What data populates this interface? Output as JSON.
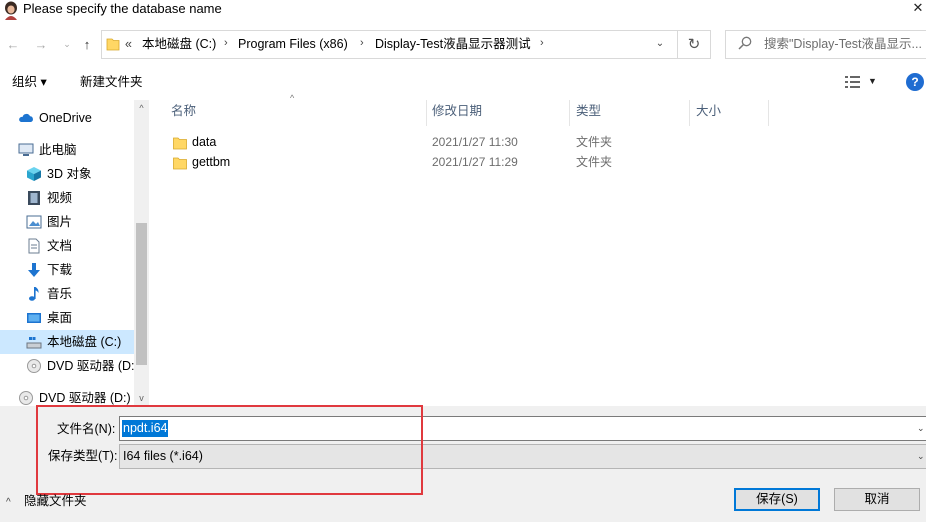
{
  "window": {
    "title": "Please specify the database name",
    "close_glyph": "✕"
  },
  "nav": {
    "back_glyph": "←",
    "forward_glyph": "→",
    "recent_glyph": "⌄",
    "up_glyph": "↑"
  },
  "address": {
    "overflow": "«",
    "crumbs": [
      "本地磁盘 (C:)",
      "Program Files (x86)",
      "Display-Test液晶显示器测试"
    ],
    "separator": "›",
    "dropdown_glyph": "⌄",
    "refresh_glyph": "↻"
  },
  "search": {
    "placeholder": "搜索\"Display-Test液晶显示..."
  },
  "toolbar": {
    "organize": "组织 ▾",
    "new_folder": "新建文件夹",
    "view_chevron": "▼",
    "help": "?"
  },
  "sidebar": {
    "scroll_up": "^",
    "scroll_down": "v",
    "items": [
      {
        "label": "OneDrive",
        "icon": "cloud-icon"
      },
      {
        "label": "此电脑",
        "icon": "computer-icon"
      },
      {
        "label": "3D 对象",
        "icon": "cube-icon"
      },
      {
        "label": "视频",
        "icon": "video-icon"
      },
      {
        "label": "图片",
        "icon": "picture-icon"
      },
      {
        "label": "文档",
        "icon": "document-icon"
      },
      {
        "label": "下载",
        "icon": "download-icon"
      },
      {
        "label": "音乐",
        "icon": "music-icon"
      },
      {
        "label": "桌面",
        "icon": "desktop-icon"
      },
      {
        "label": "本地磁盘 (C:)",
        "icon": "drive-icon",
        "selected": true
      },
      {
        "label": "DVD 驱动器 (D:",
        "icon": "dvd-icon"
      },
      {
        "label": "DVD 驱动器 (D:)",
        "icon": "dvd-icon"
      }
    ]
  },
  "files": {
    "columns": [
      "名称",
      "修改日期",
      "类型",
      "大小"
    ],
    "sort_glyph": "^",
    "rows": [
      {
        "name": "data",
        "date": "2021/1/27 11:30",
        "type": "文件夹"
      },
      {
        "name": "gettbm",
        "date": "2021/1/27 11:29",
        "type": "文件夹"
      }
    ]
  },
  "form": {
    "filename_label": "文件名(N):",
    "filename_value": "npdt.i64",
    "filetype_label": "保存类型(T):",
    "filetype_value": "I64 files (*.i64)",
    "dropdown_glyph": "⌄"
  },
  "footer": {
    "hide_folders": "隐藏文件夹",
    "hide_glyph": "^",
    "save": "保存(S)",
    "cancel": "取消"
  },
  "colors": {
    "accent": "#0078d7",
    "selection": "#cce8ff",
    "highlight_box": "#e0393e",
    "folder": "#ffd765"
  }
}
